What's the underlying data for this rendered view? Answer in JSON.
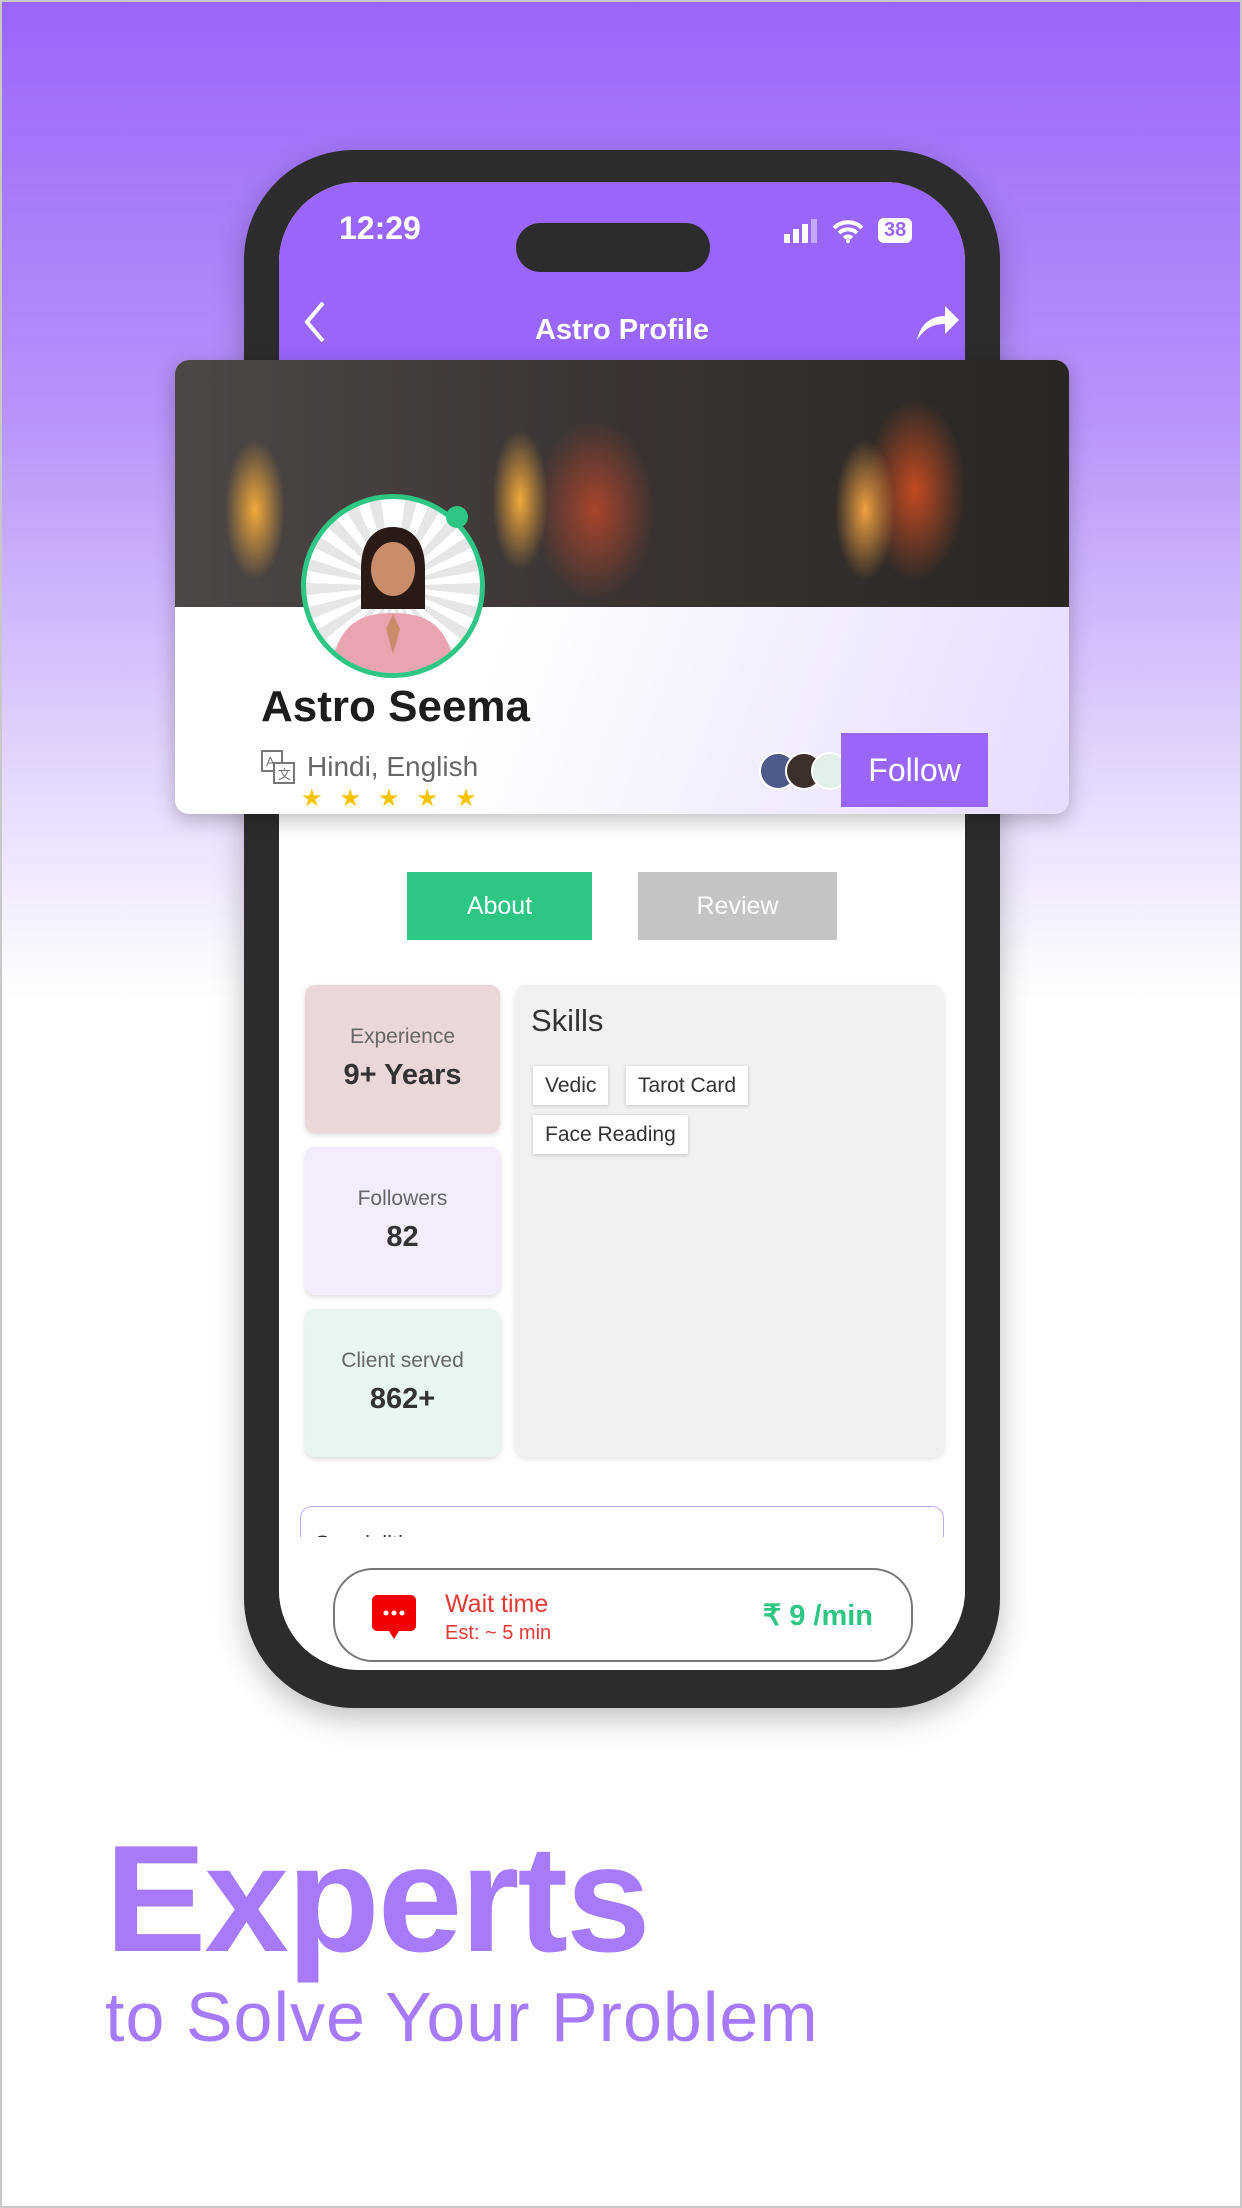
{
  "status_bar": {
    "time": "12:29",
    "battery": "38"
  },
  "header": {
    "title": "Astro Profile",
    "back_icon": "chevron-left-icon",
    "share_icon": "share-icon"
  },
  "profile": {
    "name": "Astro Seema",
    "languages": "Hindi, English",
    "rating": 5,
    "stars": "★★★★★",
    "follow_label": "Follow",
    "online": true
  },
  "tabs": [
    {
      "label": "About",
      "active": true
    },
    {
      "label": "Review",
      "active": false
    }
  ],
  "stats": [
    {
      "label": "Experience",
      "value": "9+ Years"
    },
    {
      "label": "Followers",
      "value": "82"
    },
    {
      "label": "Client served",
      "value": "862+"
    }
  ],
  "skills": {
    "title": "Skills",
    "items": [
      "Vedic",
      "Tarot Card",
      "Face Reading"
    ]
  },
  "specialities": {
    "title": "Specialities"
  },
  "bottom_bar": {
    "wait_label": "Wait time",
    "wait_est": "Est: ~ 5 min",
    "price": "₹ 9 /min"
  },
  "promo": {
    "headline": "Experts",
    "subline": "to Solve Your Problem"
  },
  "colors": {
    "accent": "#9966f9",
    "green": "#2dc685",
    "red": "#e53935",
    "star": "#f7c300"
  }
}
